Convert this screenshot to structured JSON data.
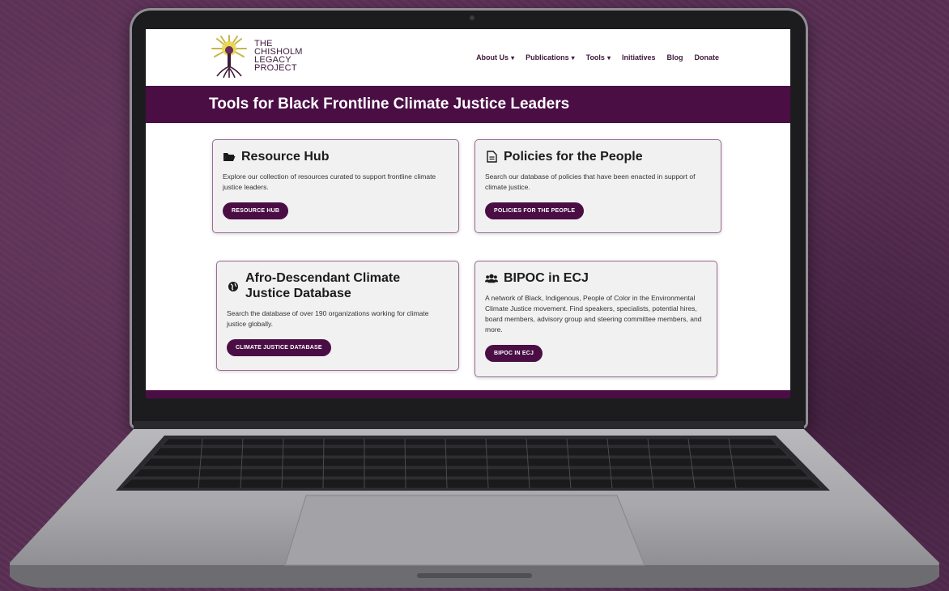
{
  "site": {
    "logo_lines": [
      "THE",
      "CHISHOLM",
      "LEGACY",
      "PROJECT"
    ],
    "nav": [
      {
        "label": "About Us",
        "dropdown": true
      },
      {
        "label": "Publications",
        "dropdown": true
      },
      {
        "label": "Tools",
        "dropdown": true
      },
      {
        "label": "Initiatives",
        "dropdown": false
      },
      {
        "label": "Blog",
        "dropdown": false
      },
      {
        "label": "Donate",
        "dropdown": false
      }
    ],
    "chevron": "⌄"
  },
  "banner": {
    "title": "Tools for Black Frontline Climate Justice Leaders"
  },
  "cards": [
    {
      "icon": "folder-open-icon",
      "title": "Resource Hub",
      "description": "Explore our collection of resources curated to support frontline climate justice leaders.",
      "button": "RESOURCE HUB"
    },
    {
      "icon": "document-icon",
      "title": "Policies for the People",
      "description": "Search our database of policies that have been enacted in support of climate justice.",
      "button": "POLICIES FOR THE PEOPLE"
    },
    {
      "icon": "globe-icon",
      "title": "Afro-Descendant Climate Justice Database",
      "description": "Search the database of over 190 organizations working for climate justice globally.",
      "button": "CLIMATE JUSTICE DATABASE"
    },
    {
      "icon": "users-icon",
      "title": "BIPOC in ECJ",
      "description": "A network of Black, Indigenous, People of Color in the Environmental Climate Justice movement. Find speakers, specialists, potential hires, board members, advisory group and steering committee members, and more.",
      "button": "BIPOC IN ECJ"
    }
  ],
  "colors": {
    "brand_plum": "#4a0e45",
    "background_purple": "#5a2f55",
    "card_border": "#9b6a95"
  }
}
